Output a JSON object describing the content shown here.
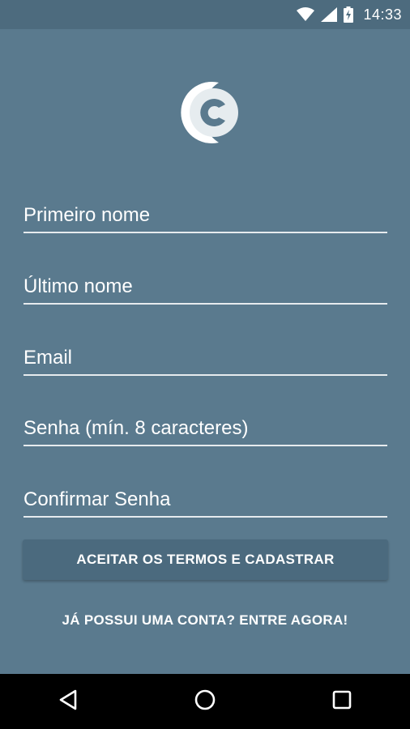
{
  "status_bar": {
    "time": "14:33",
    "icons": [
      "wifi-icon",
      "signal-icon",
      "battery-charging-icon"
    ]
  },
  "logo": {
    "icon": "app-logo-c"
  },
  "form": {
    "first_name_placeholder": "Primeiro nome",
    "last_name_placeholder": "Último nome",
    "email_placeholder": "Email",
    "password_placeholder": "Senha (mín. 8 caracteres)",
    "confirm_password_placeholder": "Confirmar Senha"
  },
  "actions": {
    "register_label": "ACEITAR OS TERMOS E CADASTRAR",
    "login_link_label": "JÁ POSSUI UMA CONTA? ENTRE AGORA!"
  },
  "nav_bar": {
    "icons": [
      "back-icon",
      "home-icon",
      "recents-icon"
    ]
  },
  "colors": {
    "background": "#5a7a8e",
    "status_bar": "#4d6b7e",
    "button": "#4b6a7e",
    "text": "#ffffff",
    "nav_bar": "#000000"
  }
}
